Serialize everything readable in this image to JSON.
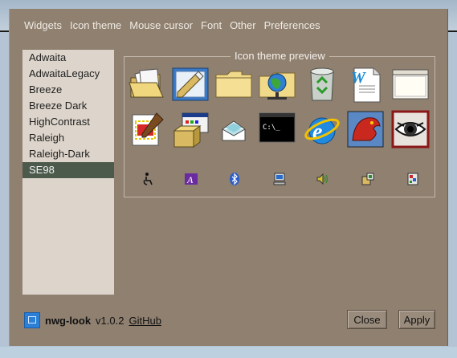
{
  "tabs": [
    "Widgets",
    "Icon theme",
    "Mouse cursor",
    "Font",
    "Other",
    "Preferences"
  ],
  "themes": [
    "Adwaita",
    "AdwaitaLegacy",
    "Breeze",
    "Breeze Dark",
    "HighContrast",
    "Raleigh",
    "Raleigh-Dark",
    "SE98"
  ],
  "selected_theme": "SE98",
  "preview": {
    "title": "Icon theme preview",
    "icons_row1": [
      "folder-open-icon",
      "folder-edit-icon",
      "folder-icon",
      "network-folder-icon",
      "recycle-bin-icon",
      "word-document-icon",
      "window-icon"
    ],
    "icons_row2": [
      "image-editor-icon",
      "install-package-icon",
      "mail-icon",
      "terminal-icon",
      "internet-explorer-icon",
      "dragon-app-icon",
      "eye-icon"
    ],
    "icons_row3": [
      "accessibility-icon",
      "font-icon",
      "bluetooth-icon",
      "computer-icon",
      "volume-icon",
      "settings-app-icon",
      "control-panel-icon"
    ]
  },
  "footer": {
    "name": "nwg-look",
    "version": "v1.0.2",
    "link": "GitHub"
  },
  "buttons": {
    "close": "Close",
    "apply": "Apply"
  },
  "colors": {
    "window_bg": "#8f8070",
    "list_bg": "#ddd5cb",
    "selected_bg": "#4c5a4c",
    "desktop": "#b4c4d4"
  }
}
